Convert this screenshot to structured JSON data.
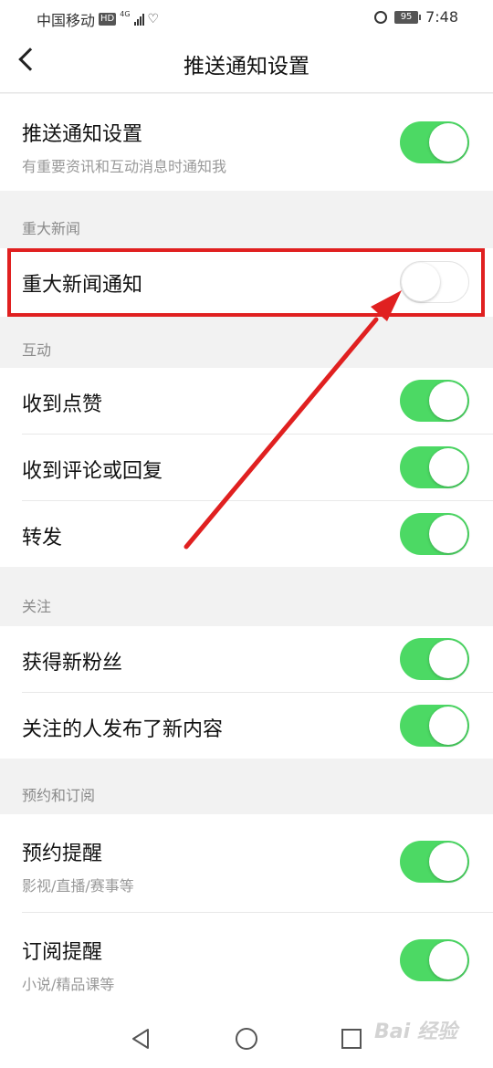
{
  "status_bar": {
    "carrier": "中国移动",
    "hd": "HD",
    "network": "4G",
    "battery": "95",
    "time": "7:48"
  },
  "header": {
    "title": "推送通知设置"
  },
  "master": {
    "label": "推送通知设置",
    "sub": "有重要资讯和互动消息时通知我",
    "on": true
  },
  "sections": {
    "major_news": "重大新闻",
    "interaction": "互动",
    "follow": "关注",
    "booking": "预约和订阅"
  },
  "items": {
    "major_news_notify": {
      "label": "重大新闻通知",
      "on": false
    },
    "likes": {
      "label": "收到点赞",
      "on": true
    },
    "comments": {
      "label": "收到评论或回复",
      "on": true
    },
    "forward": {
      "label": "转发",
      "on": true
    },
    "new_fans": {
      "label": "获得新粉丝",
      "on": true
    },
    "followed_posts": {
      "label": "关注的人发布了新内容",
      "on": true
    },
    "booking_reminder": {
      "label": "预约提醒",
      "sub": "影视/直播/赛事等",
      "on": true
    },
    "subscription_reminder": {
      "label": "订阅提醒",
      "sub": "小说/精品课等",
      "on": true
    }
  },
  "colors": {
    "toggle_on": "#4cd964",
    "annotation": "#e02020"
  },
  "watermark": "Bai 经验"
}
